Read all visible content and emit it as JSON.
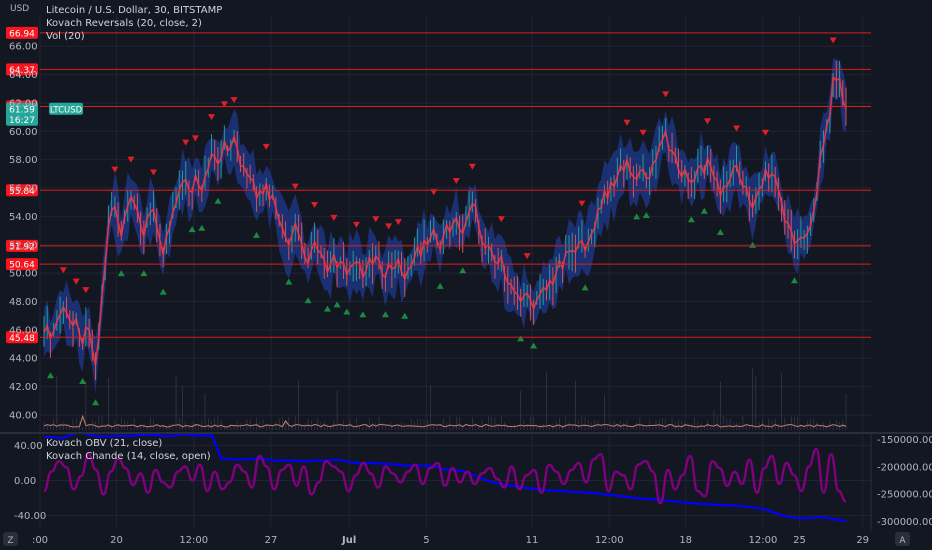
{
  "chart_data": [
    {
      "type": "line",
      "title": "Litecoin / U.S. Dollar, 30, BITSTAMP",
      "indicators": [
        "Kovach Reversals (20, close, 2)",
        "Vol (20)"
      ],
      "currency_label": "USD",
      "ylim": [
        38.8,
        68.2
      ],
      "ylabel_ticks": [
        "66.00",
        "64.00",
        "62.00",
        "60.00",
        "58.00",
        "56.00",
        "54.00",
        "52.00",
        "50.00",
        "48.00",
        "46.00",
        "44.00",
        "42.00",
        "40.00"
      ],
      "ytick_values": [
        66,
        64,
        62,
        60,
        58,
        56,
        54,
        52,
        50,
        48,
        46,
        44,
        42,
        40
      ],
      "horizontal_levels": [
        {
          "label": "66.94",
          "value": 66.94
        },
        {
          "label": "64.37",
          "value": 64.37
        },
        {
          "label": "61.75",
          "value": 61.75
        },
        {
          "label": "55.84",
          "value": 55.84
        },
        {
          "label": "51.92",
          "value": 51.92
        },
        {
          "label": "50.64",
          "value": 50.64
        },
        {
          "label": "45.48",
          "value": 45.48
        }
      ],
      "price_tag": {
        "symbol": "LTCUSD",
        "price": "61.59",
        "countdown": "16:27",
        "value": 61.59
      },
      "series": [
        {
          "values": [
            45.8,
            46.3,
            45.4,
            45.9,
            46.6,
            47.1,
            47.6,
            47.2,
            46.7,
            46.3,
            46.8,
            45.7,
            45.0,
            46.2,
            46.0,
            44.6,
            43.5,
            45.5,
            48.4,
            50.6,
            53.3,
            54.4,
            54.7,
            53.6,
            52.6,
            53.9,
            54.7,
            55.4,
            54.9,
            54.4,
            53.4,
            52.6,
            53.9,
            54.3,
            54.5,
            53.3,
            52.3,
            51.3,
            52.6,
            53.2,
            54.3,
            54.9,
            55.9,
            56.4,
            56.6,
            55.9,
            55.7,
            56.9,
            56.2,
            55.8,
            56.8,
            57.4,
            58.4,
            58.2,
            57.7,
            58.1,
            59.3,
            58.6,
            58.9,
            59.6,
            58.8,
            57.6,
            57.5,
            57.0,
            56.7,
            56.5,
            55.3,
            55.8,
            55.6,
            56.3,
            55.2,
            55.5,
            54.6,
            53.7,
            53.2,
            52.5,
            52.0,
            52.7,
            53.5,
            52.8,
            52.1,
            51.1,
            50.7,
            51.6,
            52.2,
            51.6,
            51.4,
            50.9,
            50.1,
            50.6,
            51.3,
            50.4,
            50.8,
            50.7,
            49.9,
            50.4,
            50.6,
            50.8,
            50.7,
            49.7,
            50.2,
            51.1,
            50.6,
            51.2,
            50.9,
            49.9,
            49.7,
            50.7,
            50.3,
            50.4,
            51.0,
            50.1,
            49.6,
            50.2,
            50.5,
            51.1,
            51.9,
            51.2,
            52.3,
            52.0,
            52.5,
            53.1,
            52.3,
            51.7,
            52.6,
            53.4,
            52.9,
            53.5,
            53.9,
            53.1,
            52.8,
            53.6,
            54.3,
            54.9,
            54.7,
            53.3,
            52.2,
            51.8,
            52.0,
            51.5,
            50.8,
            50.7,
            51.2,
            49.9,
            49.3,
            49.2,
            48.7,
            48.5,
            48.0,
            48.4,
            48.6,
            48.1,
            47.5,
            48.1,
            48.5,
            49.0,
            48.8,
            49.5,
            49.2,
            50.0,
            50.9,
            50.3,
            51.5,
            51.5,
            51.6,
            51.5,
            52.1,
            52.3,
            51.6,
            52.2,
            52.8,
            53.2,
            54.5,
            54.6,
            55.8,
            55.3,
            56.4,
            56.1,
            56.8,
            57.6,
            57.2,
            58.0,
            57.1,
            56.8,
            56.6,
            57.2,
            57.3,
            56.7,
            56.7,
            57.7,
            58.0,
            58.9,
            59.4,
            60.0,
            58.7,
            58.6,
            58.3,
            57.3,
            56.8,
            57.3,
            56.6,
            56.4,
            56.6,
            57.4,
            57.6,
            57.0,
            58.1,
            57.5,
            56.8,
            56.5,
            55.5,
            56.1,
            56.1,
            56.6,
            57.4,
            57.6,
            56.7,
            56.1,
            56.1,
            55.1,
            54.6,
            55.3,
            55.9,
            56.2,
            57.3,
            56.7,
            57.0,
            56.8,
            55.9,
            55.0,
            53.7,
            53.5,
            53.0,
            52.1,
            52.3,
            52.5,
            52.5,
            52.8,
            53.4,
            54.4,
            55.7,
            58.2,
            59.0,
            60.4,
            61.1,
            63.8,
            63.6,
            63.7,
            62.2,
            61.6
          ]
        }
      ]
    },
    {
      "type": "line",
      "title": "",
      "indicators": [
        "Kovach OBV (21, close)",
        "Kovach Chande (14, close, open)"
      ],
      "ylim": [
        -53,
        53
      ],
      "left_ticks": [
        "40.00",
        "0.00",
        "-40.00"
      ],
      "left_tick_values": [
        40,
        0,
        -40
      ],
      "right_ticks": [
        "-150000.00",
        "-200000.00",
        "-250000.00",
        "-300000.00"
      ],
      "right_tick_values": [
        -150000,
        -200000,
        -250000,
        -300000
      ],
      "obv_range": [
        -310000,
        -140000
      ],
      "series": [
        {
          "color": "#0000ff",
          "values": [
            -145000,
            -146000,
            -148000,
            -140000,
            -138000,
            -142000,
            -145000,
            -144000,
            -143000,
            -144000,
            -142000,
            -141000,
            -142000,
            -144000,
            -143000,
            -140000,
            -142000,
            -143000,
            -142000,
            -185000,
            -186000,
            -187000,
            -186000,
            -185000,
            -187000,
            -189000,
            -188000,
            -189000,
            -190000,
            -188000,
            -189000,
            -187000,
            -188000,
            -192000,
            -194000,
            -193000,
            -194000,
            -195000,
            -196000,
            -198000,
            -197000,
            -198000,
            -200000,
            -205000,
            -206000,
            -208000,
            -215000,
            -222000,
            -228000,
            -232000,
            -234000,
            -237000,
            -239000,
            -241000,
            -243000,
            -244000,
            -245000,
            -246000,
            -247000,
            -248000,
            -250000,
            -252000,
            -254000,
            -256000,
            -258000,
            -259000,
            -260000,
            -262000,
            -264000,
            -266000,
            -267000,
            -268000,
            -269000,
            -270000,
            -271000,
            -272000,
            -274000,
            -276000,
            -282000,
            -288000,
            -292000,
            -294000,
            -294000,
            -292000,
            -293000,
            -297000,
            -299000
          ]
        },
        {
          "color": "#800080",
          "values": [
            -12,
            10,
            22,
            15,
            -10,
            5,
            30,
            12,
            -16,
            10,
            25,
            14,
            -5,
            8,
            -14,
            12,
            -2,
            -8,
            10,
            16,
            0,
            18,
            -12,
            10,
            -10,
            -2,
            18,
            10,
            -8,
            28,
            16,
            -10,
            12,
            18,
            -6,
            16,
            -16,
            -2,
            22,
            16,
            10,
            -12,
            6,
            20,
            8,
            -8,
            16,
            8,
            -2,
            10,
            18,
            -4,
            14,
            20,
            -6,
            14,
            -2,
            10,
            -4,
            8,
            14,
            2,
            -8,
            16,
            -10,
            6,
            12,
            -14,
            18,
            10,
            -4,
            12,
            20,
            -2,
            24,
            30,
            -12,
            10,
            6,
            -10,
            18,
            22,
            10,
            -26,
            12,
            -10,
            6,
            28,
            -12,
            -18,
            22,
            14,
            -6,
            10,
            -4,
            24,
            -14,
            14,
            28,
            -4,
            20,
            6,
            -12,
            16,
            36,
            -14,
            30,
            -12,
            -24
          ]
        }
      ]
    }
  ],
  "x_ticks": [
    ":00",
    "20",
    "12:00",
    "27",
    "Jul",
    "5",
    "11",
    "12:00",
    "18",
    "12:00",
    "25",
    "29"
  ],
  "x_tick_values": [
    0.0,
    0.092,
    0.185,
    0.278,
    0.372,
    0.465,
    0.592,
    0.685,
    0.777,
    0.87,
    0.914,
    0.99
  ],
  "x_bold": [
    "Jul"
  ],
  "chart_controls": {
    "timezone_badge": "Z",
    "autoscale_badge": "A"
  },
  "colors": {
    "background": "#131722",
    "grid": "#1f2433",
    "level_line": "#d81e1e",
    "level_badge": "#f7151e",
    "price_line": "#f23645",
    "candle_up": "#26a69a",
    "candle_down": "#ef5350",
    "band_fill": "#1f3a8f",
    "buy_arrow": "#1b8a3c",
    "sell_arrow": "#e01e28",
    "price_tag": "#26a69a",
    "volume_line": "#f8a080",
    "obv_line": "#0000ff",
    "chande_line": "#800080"
  }
}
